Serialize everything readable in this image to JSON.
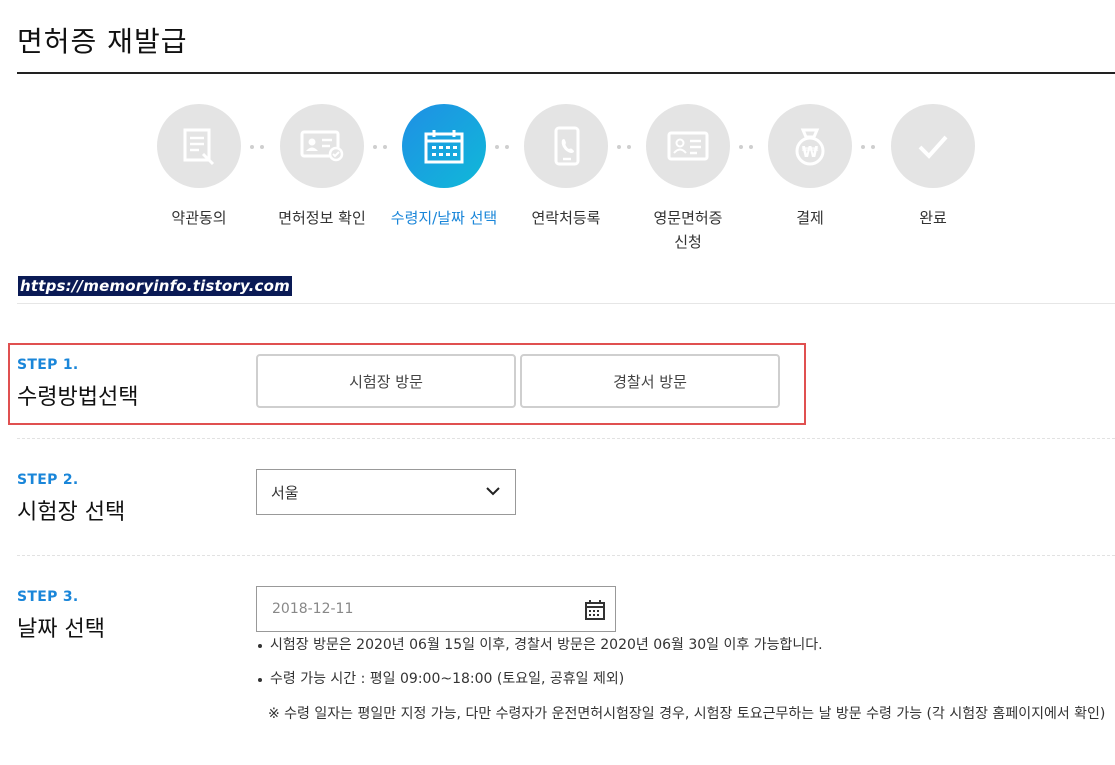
{
  "page": {
    "title": "면허증 재발급"
  },
  "steps": [
    {
      "label": "약관동의",
      "icon": "document-edit-icon",
      "active": false
    },
    {
      "label": "면허정보 확인",
      "icon": "license-check-icon",
      "active": false
    },
    {
      "label": "수령지/날짜 선택",
      "icon": "calendar-icon",
      "active": true
    },
    {
      "label": "연락처등록",
      "icon": "phone-icon",
      "active": false
    },
    {
      "label": "영문면허증 신청",
      "line1": "영문면허증",
      "line2": "신청",
      "icon": "id-card-icon",
      "active": false
    },
    {
      "label": "결제",
      "icon": "money-bag-icon",
      "active": false
    },
    {
      "label": "완료",
      "icon": "check-icon",
      "active": false
    }
  ],
  "watermark": "https://memoryinfo.tistory.com",
  "step1": {
    "no": "STEP 1.",
    "title": "수령방법선택",
    "options": [
      "시험장 방문",
      "경찰서 방문"
    ]
  },
  "step2": {
    "no": "STEP 2.",
    "title": "시험장 선택",
    "selected": "서울"
  },
  "step3": {
    "no": "STEP 3.",
    "title": "날짜 선택",
    "date": "2018-12-11",
    "note1": "시험장 방문은 2020년 06월 15일 이후, 경찰서 방문은 2020년 06월 30일 이후 가능합니다.",
    "note2": "수령 가능 시간 : 평일 09:00~18:00 (토요일, 공휴일 제외)",
    "remark": "※ 수령 일자는 평일만 지정 가능, 다만 수령자가 운전면허시험장일 경우, 시험장 토요근무하는 날 방문 수령 가능 (각 시험장 홈페이지에서 확인)"
  },
  "colors": {
    "accent": "#1a86d9",
    "highlight": "#e05050",
    "inactive_circle": "#e4e4e4"
  }
}
